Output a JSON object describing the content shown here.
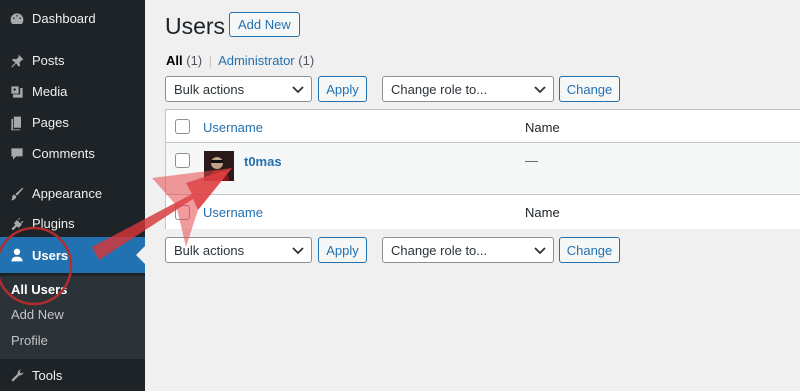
{
  "sidebar": {
    "items": [
      {
        "label": "Dashboard",
        "icon": "dashboard-icon"
      },
      {
        "label": "Posts",
        "icon": "pin-icon"
      },
      {
        "label": "Media",
        "icon": "media-icon"
      },
      {
        "label": "Pages",
        "icon": "pages-icon"
      },
      {
        "label": "Comments",
        "icon": "comments-icon"
      },
      {
        "label": "Appearance",
        "icon": "brush-icon"
      },
      {
        "label": "Plugins",
        "icon": "plug-icon"
      },
      {
        "label": "Users",
        "icon": "user-icon"
      },
      {
        "label": "Tools",
        "icon": "wrench-icon"
      }
    ],
    "submenu": [
      "All Users",
      "Add New",
      "Profile"
    ]
  },
  "header": {
    "title": "Users",
    "add_new": "Add New"
  },
  "filters": {
    "all": "All",
    "all_count": "(1)",
    "separator": "|",
    "admin": "Administrator",
    "admin_count": "(1)"
  },
  "bulk": {
    "label": "Bulk actions",
    "apply": "Apply"
  },
  "role": {
    "label": "Change role to...",
    "change": "Change"
  },
  "table": {
    "columns": [
      "Username",
      "Name"
    ],
    "rows": [
      {
        "username": "t0mas",
        "name": "—"
      }
    ]
  },
  "colors": {
    "accent": "#2271b1",
    "sidebar": "#1d2327",
    "annotation": "#d63638"
  }
}
